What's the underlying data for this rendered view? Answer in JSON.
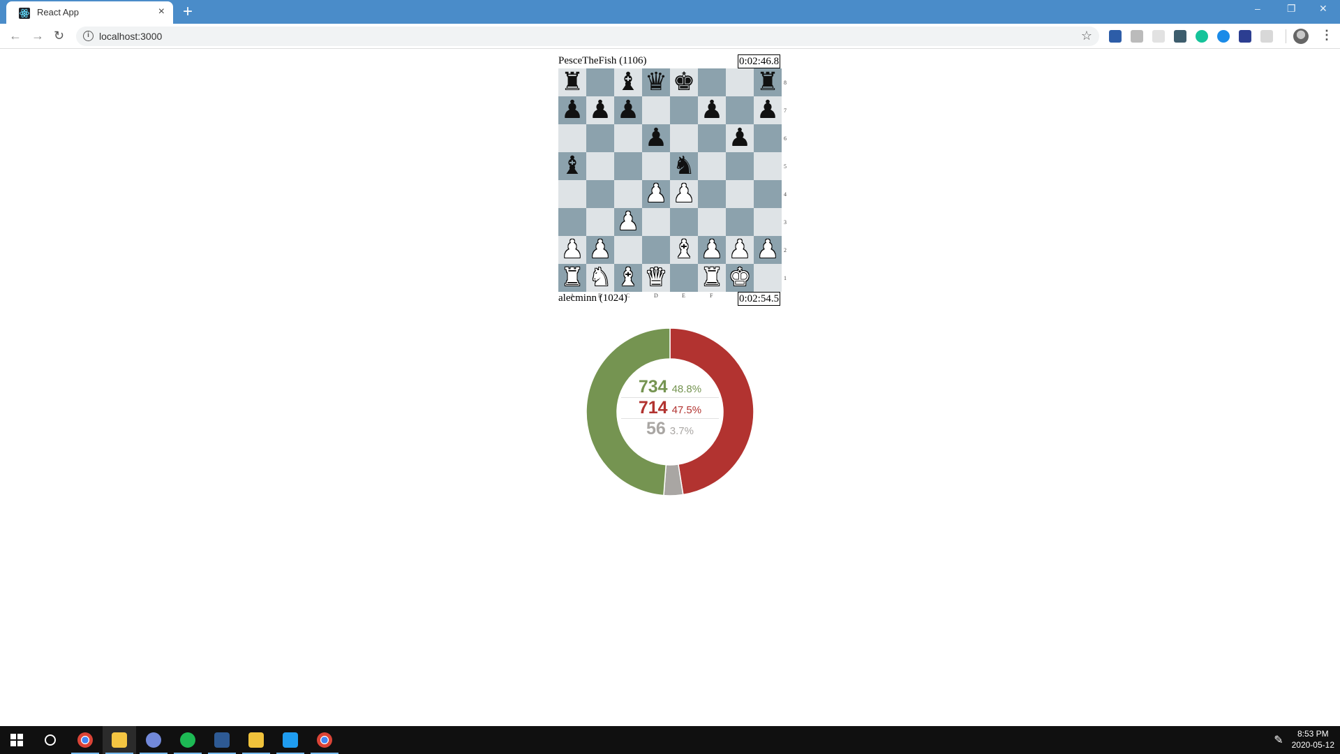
{
  "browser": {
    "tab_title": "React App",
    "tab_close": "×",
    "new_tab": "+",
    "url": "localhost:3000",
    "info_glyph": "i",
    "star_glyph": "☆",
    "win_min": "–",
    "win_restore": "❐",
    "win_close": "✕",
    "extension_icons": [
      "sale-off-icon",
      "extension-icon",
      "extension-icon",
      "extension-icon",
      "grammarly-icon",
      "extension-icon",
      "screen-icon",
      "reading-list-icon"
    ],
    "menu_glyph": "⋮"
  },
  "game": {
    "top_player": {
      "name": "PesceTheFish (1106)",
      "clock": "0:02:46.8"
    },
    "bottom_player": {
      "name": "alecminn (1024)",
      "clock": "0:02:54.5"
    },
    "ranks": [
      "8",
      "7",
      "6",
      "5",
      "4",
      "3",
      "2",
      "1"
    ],
    "files": [
      "A",
      "B",
      "C",
      "D",
      "E",
      "F",
      "G",
      "H"
    ],
    "board": [
      [
        "br",
        "",
        "bb",
        "bq",
        "bk",
        "",
        "",
        "br"
      ],
      [
        "bp",
        "bp",
        "bp",
        "",
        "",
        "bp",
        "",
        "bp"
      ],
      [
        "",
        "",
        "",
        "bp",
        "",
        "",
        "bp",
        ""
      ],
      [
        "bb",
        "",
        "",
        "",
        "bn",
        "",
        "",
        ""
      ],
      [
        "",
        "",
        "",
        "wp",
        "wp",
        "",
        "",
        ""
      ],
      [
        "",
        "",
        "wp",
        "",
        "",
        "",
        "",
        ""
      ],
      [
        "wp",
        "wp",
        "",
        "",
        "wb",
        "wp",
        "wp",
        "wp"
      ],
      [
        "wr",
        "wn",
        "wb",
        "wq",
        "",
        "wr",
        "wk",
        ""
      ]
    ],
    "colors": {
      "light": "#dee3e6",
      "dark": "#8ca2ad"
    }
  },
  "stats": {
    "wins": {
      "count": "734",
      "percent": "48.8%",
      "fraction": 0.488,
      "color": "#759451"
    },
    "losses": {
      "count": "714",
      "percent": "47.5%",
      "fraction": 0.475,
      "color": "#b23330"
    },
    "draws": {
      "count": "56",
      "percent": "3.7%",
      "fraction": 0.037,
      "color": "#a9a6a3"
    }
  },
  "taskbar": {
    "apps": [
      "chrome-icon",
      "file-explorer-icon",
      "discord-icon",
      "spotify-icon",
      "visual-studio-icon",
      "git-icon",
      "vscode-icon",
      "chrome-icon"
    ],
    "time": "8:53 PM",
    "date": "2020-05-12"
  }
}
